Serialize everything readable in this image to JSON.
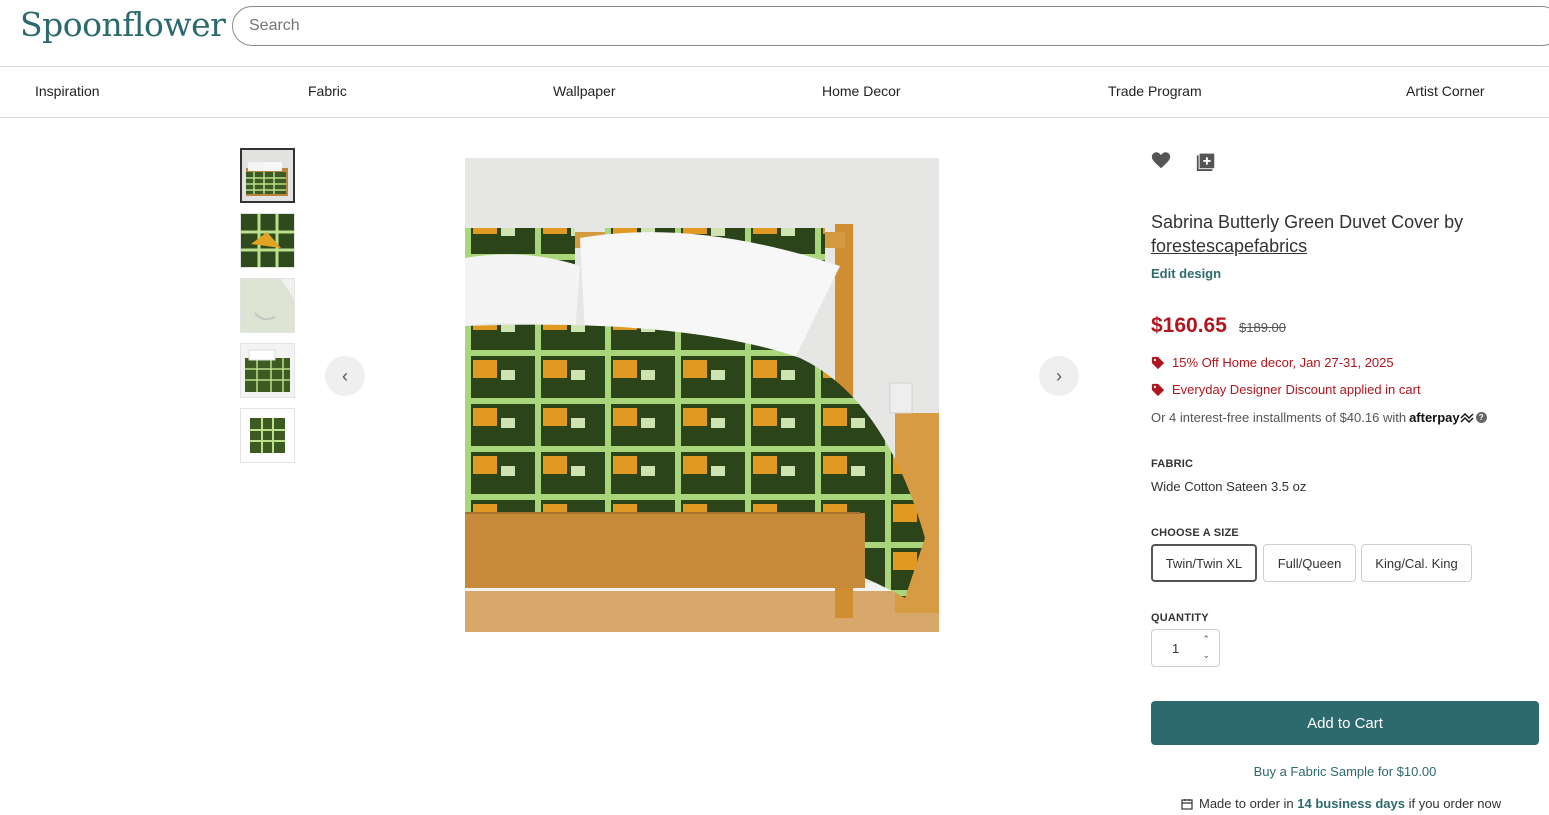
{
  "brand": {
    "logo": "Spoonflower",
    "accent": "#2d6a6e",
    "sale_red": "#b0161f"
  },
  "search": {
    "placeholder": "Search"
  },
  "nav": {
    "items": [
      {
        "label": "Inspiration"
      },
      {
        "label": "Fabric"
      },
      {
        "label": "Wallpaper"
      },
      {
        "label": "Home Decor"
      },
      {
        "label": "Trade Program"
      },
      {
        "label": "Artist Corner"
      }
    ]
  },
  "gallery": {
    "thumbnails": [
      "duvet-bed-view",
      "butterfly-closeup",
      "fabric-corner",
      "folded-duvet",
      "swatch"
    ],
    "selected_index": 0,
    "prev_icon": "chevron-left-icon",
    "next_icon": "chevron-right-icon"
  },
  "product": {
    "title_prefix": "Sabrina Butterly Green Duvet Cover by",
    "designer": "forestescapefabrics",
    "edit_design": "Edit design",
    "price": "$160.65",
    "original_price": "$189.00",
    "promos": [
      {
        "text": "15% Off Home decor, Jan 27-31, 2025",
        "icon": "tag-icon"
      },
      {
        "text": "Everyday Designer Discount applied in cart",
        "icon": "tag-icon"
      }
    ],
    "installments_text": "Or 4 interest-free installments of $40.16 with",
    "afterpay_label": "afterpay",
    "fabric_label": "FABRIC",
    "fabric_value": "Wide Cotton Sateen 3.5 oz",
    "size_label": "CHOOSE A SIZE",
    "sizes": [
      {
        "label": "Twin/Twin XL",
        "selected": true
      },
      {
        "label": "Full/Queen",
        "selected": false
      },
      {
        "label": "King/Cal. King",
        "selected": false
      }
    ],
    "quantity_label": "QUANTITY",
    "quantity": "1",
    "add_to_cart": "Add to Cart",
    "sample_link": "Buy a Fabric Sample for $10.00",
    "made_to_order_prefix": "Made to order in",
    "made_to_order_days": "14 business days",
    "made_to_order_suffix": "if you order now"
  }
}
